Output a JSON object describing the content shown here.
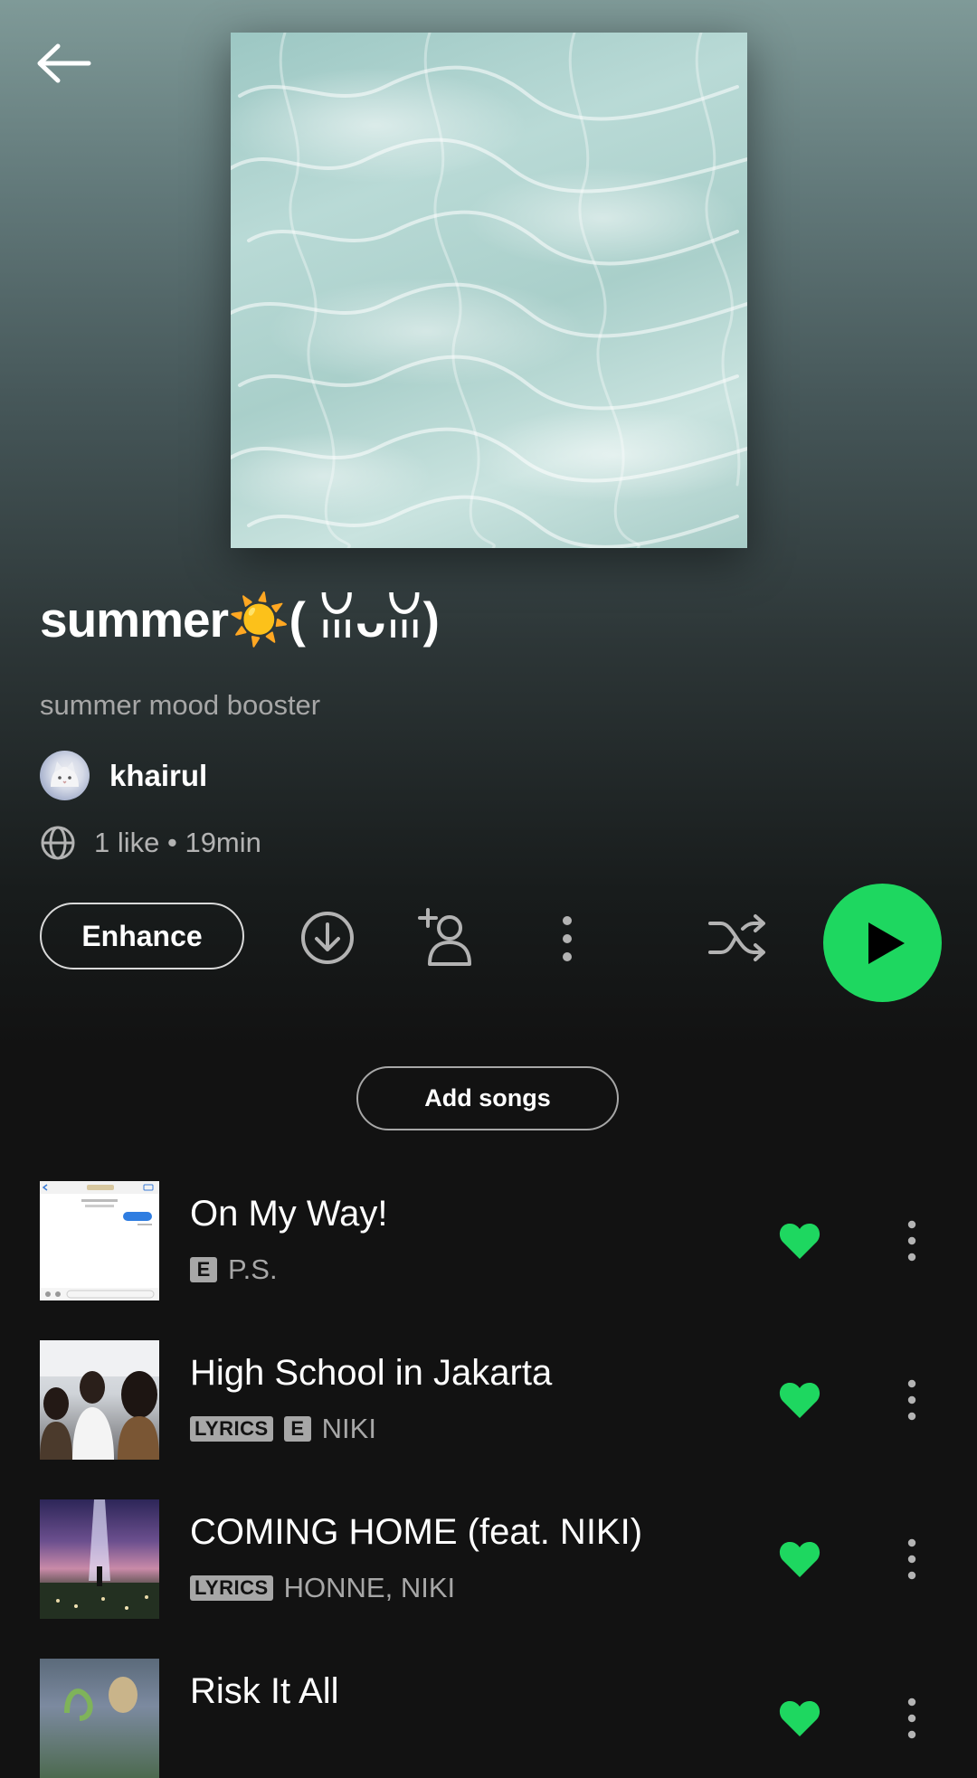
{
  "header": {
    "back_icon": "arrow-left-icon"
  },
  "playlist": {
    "cover_icon": "water-ripple-cover",
    "title": "summer☀️( ꈍᴗꈍ)",
    "description": "summer mood booster",
    "owner": {
      "name": "khairul",
      "avatar_icon": "cat-avatar"
    },
    "meta": "1 like • 19min",
    "meta_icon": "globe-icon"
  },
  "actions": {
    "enhance_label": "Enhance",
    "download_icon": "download-icon",
    "add_user_icon": "add-user-icon",
    "more_icon": "more-vertical-icon",
    "shuffle_icon": "shuffle-icon",
    "play_icon": "play-icon",
    "play_color": "#1ed760"
  },
  "add_songs_label": "Add songs",
  "tracks": [
    {
      "title": "On My Way!",
      "artists": "P.S.",
      "explicit_badge": "E",
      "liked": true
    },
    {
      "title": "High School in Jakarta",
      "artists": "NIKI",
      "lyrics_badge": "LYRICS",
      "explicit_badge": "E",
      "liked": true
    },
    {
      "title": "COMING HOME (feat. NIKI)",
      "artists": "HONNE, NIKI",
      "lyrics_badge": "LYRICS",
      "liked": true
    },
    {
      "title": "Risk It All",
      "artists": "",
      "liked": true
    }
  ],
  "colors": {
    "background": "#121212",
    "accent": "#1ed760",
    "secondary_text": "#a7a7a7"
  }
}
